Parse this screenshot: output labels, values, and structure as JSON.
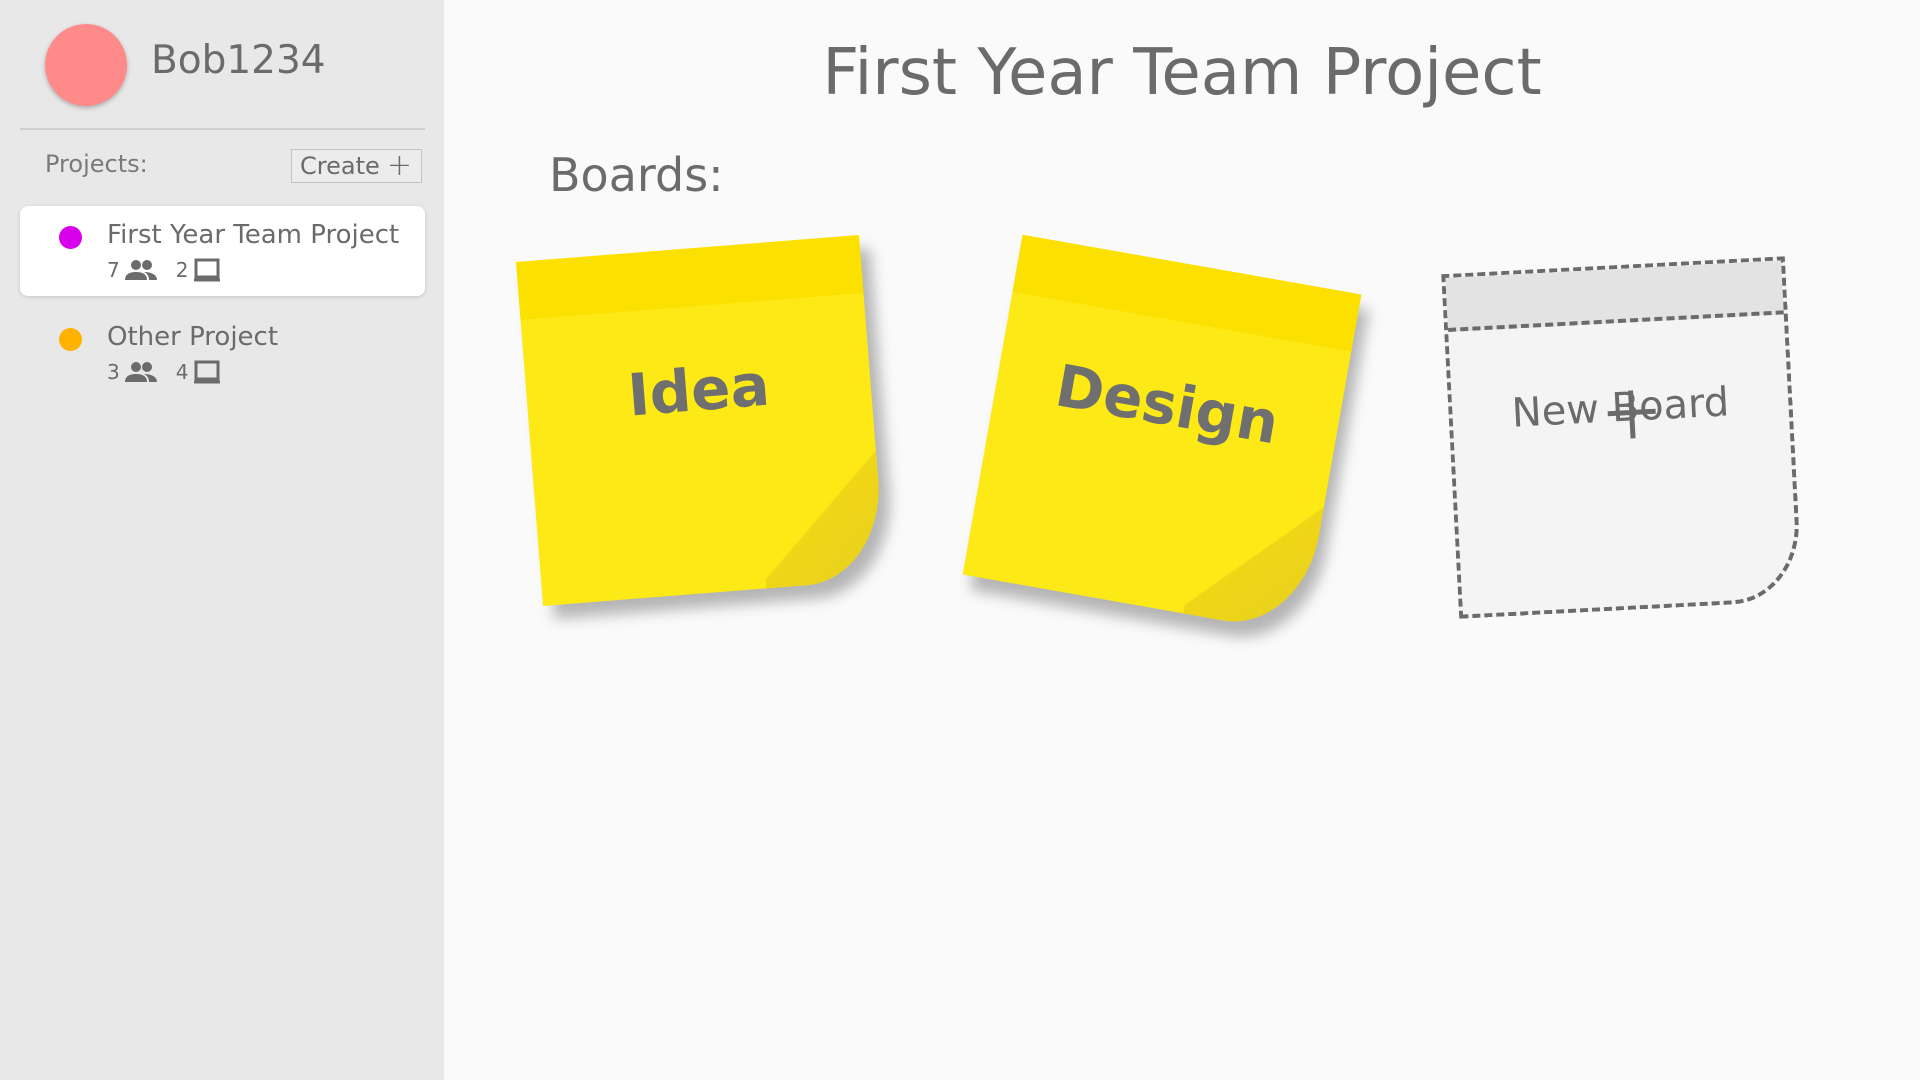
{
  "user": {
    "name": "Bob1234",
    "avatar_color": "#ff8a8a"
  },
  "sidebar": {
    "projects_label": "Projects:",
    "create_label": "Create",
    "create_icon": "plus-icon",
    "projects": [
      {
        "name": "First Year Team Project",
        "color": "#d800ec",
        "members": "7",
        "boards": "2",
        "active": true
      },
      {
        "name": "Other Project",
        "color": "#ffb300",
        "members": "3",
        "boards": "4",
        "active": false
      }
    ]
  },
  "main": {
    "title": "First Year Team Project",
    "boards_label": "Boards:",
    "boards": [
      {
        "name": "Idea",
        "color": "#fce916"
      },
      {
        "name": "Design",
        "color": "#fce916"
      }
    ],
    "new_board_label": "New Board"
  },
  "icons": {
    "members": "people-icon",
    "boards": "board-icon"
  }
}
